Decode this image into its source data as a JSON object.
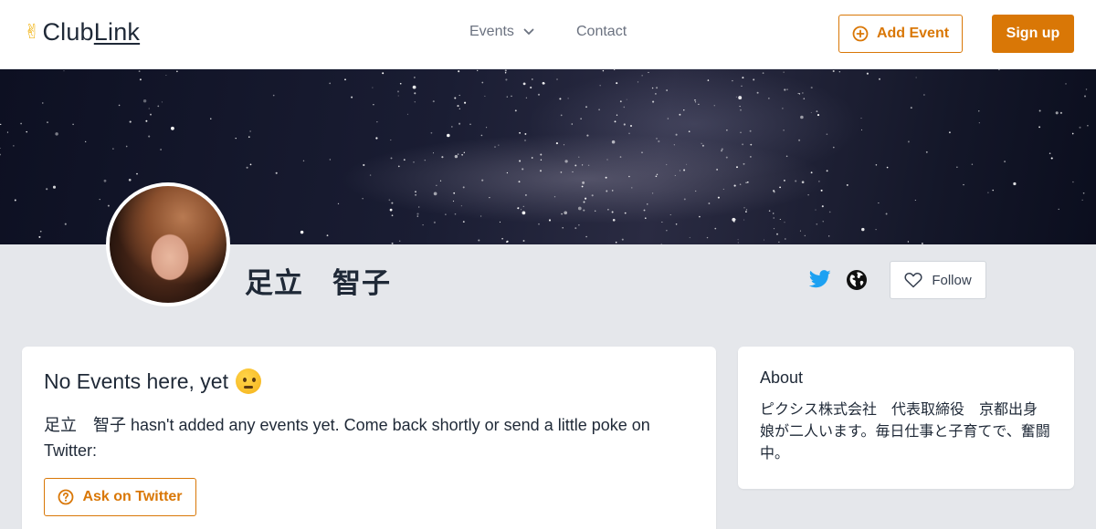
{
  "header": {
    "logo_prefix": "Club",
    "logo_suffix": "Link",
    "nav": {
      "events_label": "Events",
      "contact_label": "Contact"
    },
    "add_event_label": "Add Event",
    "signup_label": "Sign up"
  },
  "profile": {
    "name": "足立　智子",
    "follow_label": "Follow"
  },
  "events": {
    "title": "No Events here, yet",
    "message": "足立　智子 hasn't added any events yet. Come back shortly or send a little poke on Twitter:",
    "ask_label": "Ask on Twitter"
  },
  "about": {
    "title": "About",
    "text": "ピクシス株式会社　代表取締役　京都出身　娘が二人います。毎日仕事と子育てで、奮闘中。"
  },
  "colors": {
    "accent": "#d97706",
    "twitter": "#1da1f2",
    "page_bg": "#e5e7eb"
  },
  "icons": [
    "victory-hand-icon",
    "chevron-down-icon",
    "plus-circle-icon",
    "twitter-icon",
    "globe-icon",
    "heart-icon",
    "thinking-face-icon",
    "question-circle-icon"
  ]
}
